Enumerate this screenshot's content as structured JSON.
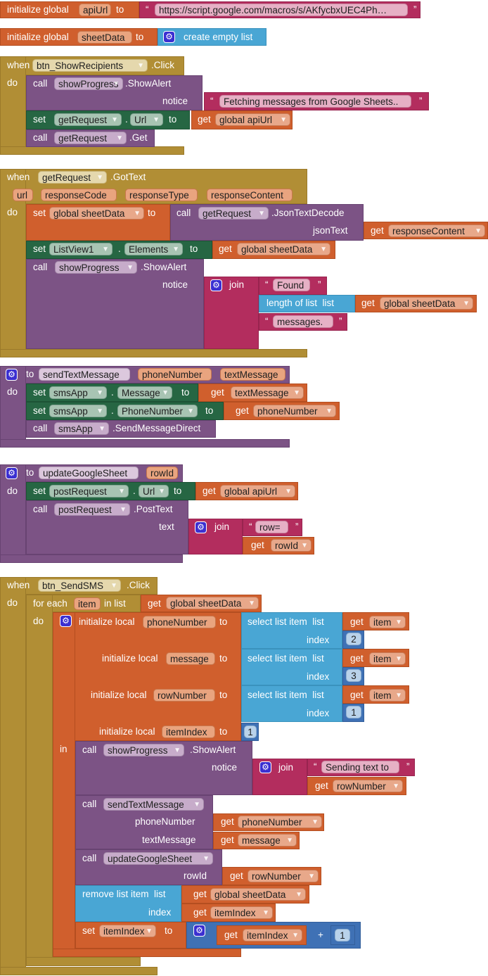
{
  "kw": {
    "when": "when",
    "do": "do",
    "call": "call",
    "set": "set",
    "get": "get",
    "to": "to",
    "dot": ".",
    "notice": "notice",
    "join": "join",
    "in": "in",
    "for_each": "for each",
    "in_list": "in list",
    "init_global": "initialize global",
    "init_local": "initialize local",
    "select_list": "select list item  list",
    "index": "index",
    "length_list": "length of list  list",
    "remove_list": "remove list item  list",
    "plus": "+",
    "open_quote": "“",
    "close_quote": "”",
    "text": "text",
    "jsonText": "jsonText",
    "phoneNumber": "phoneNumber",
    "textMessage": "textMessage",
    "rowId": "rowId",
    "create_empty_list": "create empty list"
  },
  "globals": {
    "apiUrl": {
      "name": "apiUrl",
      "value": "https://script.google.com/macros/s/AKfycbxUEC4Ph…"
    },
    "sheetData": {
      "name": "sheetData"
    }
  },
  "components": {
    "btn_ShowRecipients": "btn_ShowRecipients",
    "btn_SendSMS": "btn_SendSMS",
    "showProgress": "showProgress",
    "getRequest": "getRequest",
    "postRequest": "postRequest",
    "ListView1": "ListView1",
    "smsApp": "smsApp"
  },
  "events": {
    "click": ".Click",
    "gotText": ".GotText"
  },
  "methods": {
    "showAlert": ".ShowAlert",
    "get": ".Get",
    "jsonTextDecode": ".JsonTextDecode",
    "sendMessageDirect": ".SendMessageDirect",
    "postText": ".PostText"
  },
  "properties": {
    "url": "Url",
    "elements": "Elements",
    "message": "Message",
    "phoneNumber": "PhoneNumber"
  },
  "vars": {
    "global_apiUrl": "global apiUrl",
    "global_sheetData": "global sheetData",
    "url": "url",
    "responseCode": "responseCode",
    "responseType": "responseType",
    "responseContent": "responseContent",
    "phoneNumber": "phoneNumber",
    "textMessage": "textMessage",
    "rowId": "rowId",
    "item": "item",
    "message": "message",
    "rowNumber": "rowNumber",
    "itemIndex": "itemIndex"
  },
  "procedures": {
    "sendTextMessage": "sendTextMessage",
    "updateGoogleSheet": "updateGoogleSheet"
  },
  "strings": {
    "fetching": "Fetching messages from Google Sheets..",
    "found": "Found",
    "messages": "messages.",
    "row": "row=",
    "sending": "Sending text to"
  },
  "numbers": {
    "two": "2",
    "three": "3",
    "one": "1"
  },
  "icons": {
    "mutator": "gear-icon",
    "dropdown": "dropdown-arrow-icon"
  },
  "colors": {
    "event": "#b18e35",
    "variable": "#d05f2d",
    "text": "#b32d5e",
    "component_procedure": "#7c5385",
    "setter": "#266643",
    "list": "#49a6d4",
    "math": "#3f71b5"
  }
}
